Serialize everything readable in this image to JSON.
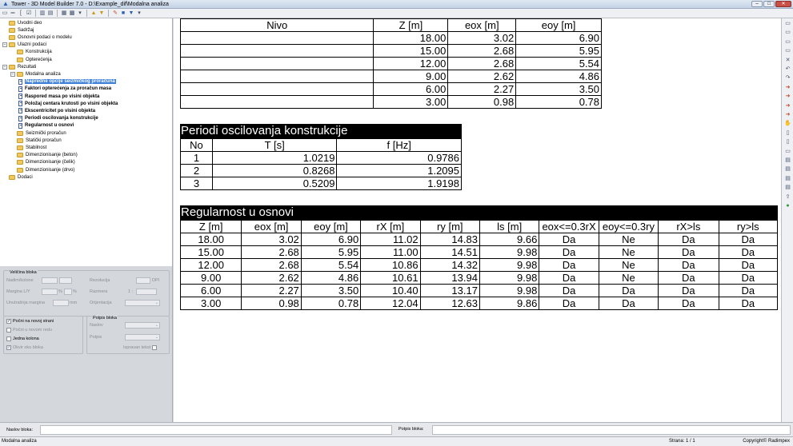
{
  "window": {
    "title": "Tower - 3D Model Builder 7.0 - D:\\Example_dif\\Modalna analiza",
    "controls": {
      "minimize": "–",
      "maximize": "□",
      "close": "✕"
    }
  },
  "toolbar_icons": [
    "page-icon",
    "ruler-icon",
    "bracket-icon",
    "check-icon",
    "columns-icon",
    "rows-icon",
    "table-icon",
    "grid-icon",
    "arrow-down-icon",
    "up-icon",
    "down-icon",
    "edit-icon",
    "save-icon",
    "filter-icon",
    "dropdown-icon"
  ],
  "tree": {
    "items": [
      {
        "label": "Uvodni deo",
        "level": 0,
        "type": "folder",
        "expander": ""
      },
      {
        "label": "Sadržaj",
        "level": 0,
        "type": "folder",
        "expander": ""
      },
      {
        "label": "Osnovni podaci o modelu",
        "level": 0,
        "type": "folder",
        "expander": ""
      },
      {
        "label": "Ulazni podaci",
        "level": 0,
        "type": "folder",
        "expander": "−"
      },
      {
        "label": "Konstrukcija",
        "level": 1,
        "type": "folder",
        "expander": ""
      },
      {
        "label": "Opterećenja",
        "level": 1,
        "type": "folder",
        "expander": ""
      },
      {
        "label": "Rezultati",
        "level": 0,
        "type": "folder",
        "expander": "−"
      },
      {
        "label": "Modalna analiza",
        "level": 1,
        "type": "folder",
        "expander": "−"
      },
      {
        "label": "Napredne opcije seizmičkog proračuna",
        "level": 2,
        "type": "doc",
        "bold": true,
        "selected": true
      },
      {
        "label": "Faktori opterećenja za proračun masa",
        "level": 2,
        "type": "doc",
        "bold": true
      },
      {
        "label": "Raspored masa po visini objekta",
        "level": 2,
        "type": "doc",
        "bold": true
      },
      {
        "label": "Položaj centara krutosti po visini objekta",
        "level": 2,
        "type": "doc",
        "bold": true
      },
      {
        "label": "Ekscentricitet po visini objekta",
        "level": 2,
        "type": "doc",
        "bold": true
      },
      {
        "label": "Periodi oscilovanja konstrukcije",
        "level": 2,
        "type": "doc",
        "bold": true
      },
      {
        "label": "Regularnost u osnovi",
        "level": 2,
        "type": "doc",
        "bold": true
      },
      {
        "label": "Seizmički proračun",
        "level": 1,
        "type": "folder",
        "expander": ""
      },
      {
        "label": "Statički proračun",
        "level": 1,
        "type": "folder",
        "expander": ""
      },
      {
        "label": "Stabilnost",
        "level": 1,
        "type": "folder",
        "expander": ""
      },
      {
        "label": "Dimenzionisanje (beton)",
        "level": 1,
        "type": "folder",
        "expander": ""
      },
      {
        "label": "Dimenzionisanje (čelik)",
        "level": 1,
        "type": "folder",
        "expander": ""
      },
      {
        "label": "Dimenzionisanje (drvo)",
        "level": 1,
        "type": "folder",
        "expander": ""
      },
      {
        "label": "Dodaci",
        "level": 0,
        "type": "folder",
        "expander": ""
      }
    ]
  },
  "props": {
    "velicina_bloka": {
      "title": "Veličina bloka",
      "nadimi_kolone": "Nadim/kolone",
      "margina_lr": "Margina L/Y",
      "unutrasnja_margina": "Unutrašnja margina",
      "pct1": "%",
      "pct2": "%",
      "mm": "mm",
      "rezolucija": "Rezolucija",
      "dpi": "DPI",
      "razmera": "Razmera",
      "razmera_sep": "1 :",
      "orijentacija": "Orijentacija",
      "dropdown_caret": "⌄"
    },
    "checks": {
      "pocni_na_novoj_strani": {
        "label": "Počni na novoj strani",
        "checked": true
      },
      "pocni_u_novom_redu": {
        "label": "Počni u novom redu",
        "checked": false
      },
      "jedna_kolona": {
        "label": "Jedna kolona",
        "checked": false
      },
      "okvir_oko_bloka": {
        "label": "Okvir oko bloka",
        "checked": true
      },
      "check_mark": "✓"
    },
    "potpis_bloka": {
      "title": "Potpis bloka",
      "naslov": "Naslov",
      "potpis": "Potpis",
      "ispravan_tekst": "Ispravan tekst"
    }
  },
  "bottom": {
    "naslov_bloka": "Naslov bloka:",
    "potpis_bloka": "Potpis bloka:"
  },
  "status": {
    "left": "Modalna analiza",
    "page": "Strana: 1 / 1",
    "copyright": "Copyright© Radimpex"
  },
  "ecc_table": {
    "headers": [
      "Nivo",
      "Z [m]",
      "eox [m]",
      "eoy [m]"
    ],
    "rows": [
      [
        "",
        "18.00",
        "3.02",
        "6.90"
      ],
      [
        "",
        "15.00",
        "2.68",
        "5.95"
      ],
      [
        "",
        "12.00",
        "2.68",
        "5.54"
      ],
      [
        "",
        "9.00",
        "2.62",
        "4.86"
      ],
      [
        "",
        "6.00",
        "2.27",
        "3.50"
      ],
      [
        "",
        "3.00",
        "0.98",
        "0.78"
      ]
    ]
  },
  "periods": {
    "title": "Periodi oscilovanja konstrukcije",
    "headers": [
      "No",
      "T [s]",
      "f [Hz]"
    ],
    "rows": [
      [
        "1",
        "1.0219",
        "0.9786"
      ],
      [
        "2",
        "0.8268",
        "1.2095"
      ],
      [
        "3",
        "0.5209",
        "1.9198"
      ]
    ]
  },
  "regularity": {
    "title": "Regularnost u osnovi",
    "headers": [
      "Z [m]",
      "eox [m]",
      "eoy [m]",
      "rX [m]",
      "ry [m]",
      "ls [m]",
      "eox<=0.3rX",
      "eoy<=0.3ry",
      "rX>ls",
      "ry>ls"
    ],
    "rows": [
      [
        "18.00",
        "3.02",
        "6.90",
        "11.02",
        "14.83",
        "9.66",
        "Da",
        "Ne",
        "Da",
        "Da"
      ],
      [
        "15.00",
        "2.68",
        "5.95",
        "11.00",
        "14.51",
        "9.98",
        "Da",
        "Ne",
        "Da",
        "Da"
      ],
      [
        "12.00",
        "2.68",
        "5.54",
        "10.86",
        "14.32",
        "9.98",
        "Da",
        "Ne",
        "Da",
        "Da"
      ],
      [
        "9.00",
        "2.62",
        "4.86",
        "10.61",
        "13.94",
        "9.98",
        "Da",
        "Ne",
        "Da",
        "Da"
      ],
      [
        "6.00",
        "2.27",
        "3.50",
        "10.40",
        "13.17",
        "9.98",
        "Da",
        "Da",
        "Da",
        "Da"
      ],
      [
        "3.00",
        "0.98",
        "0.78",
        "12.04",
        "12.63",
        "9.86",
        "Da",
        "Da",
        "Da",
        "Da"
      ]
    ]
  },
  "right_toolbar_icons": [
    "page-icon",
    "page-icon",
    "page-icon",
    "page-icon",
    "close-icon",
    "undo-icon",
    "redo-icon",
    "arrow-icon",
    "arrow-icon",
    "arrow-icon",
    "arrow-icon",
    "hand-icon",
    "blank-icon",
    "blank-icon",
    "page-icon",
    "print-icon",
    "print-icon",
    "print-icon",
    "print-icon",
    "export-icon",
    "refresh-icon"
  ]
}
